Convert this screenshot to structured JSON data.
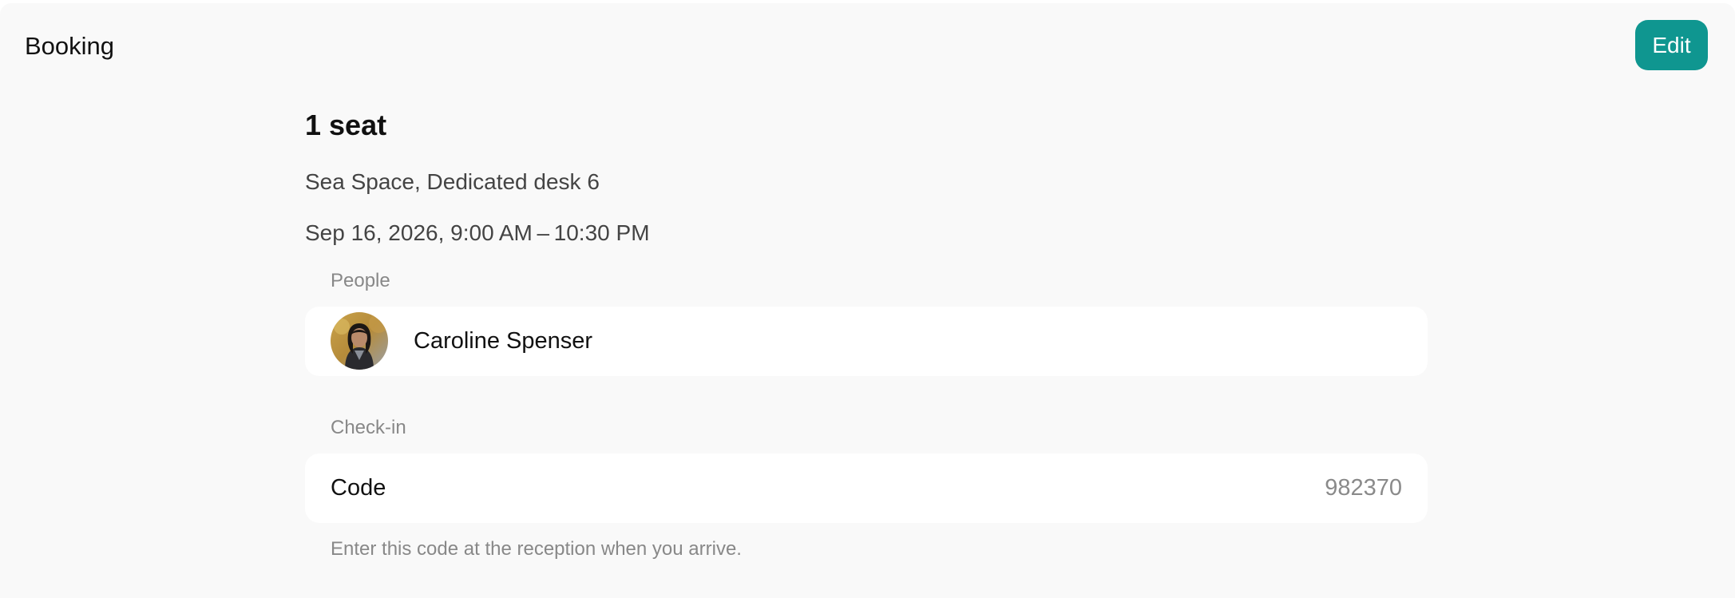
{
  "header": {
    "title": "Booking",
    "edit_label": "Edit"
  },
  "booking": {
    "seat_title": "1 seat",
    "location": "Sea Space, Dedicated desk 6",
    "datetime": "Sep 16, 2026, 9:00 AM – 10:30 PM"
  },
  "people": {
    "section_label": "People",
    "items": [
      {
        "name": "Caroline Spenser"
      }
    ]
  },
  "checkin": {
    "section_label": "Check-in",
    "code_label": "Code",
    "code_value": "982370",
    "hint": "Enter this code at the reception when you arrive."
  },
  "colors": {
    "accent": "#0f9690",
    "background": "#f9f9f9",
    "card": "#ffffff"
  }
}
